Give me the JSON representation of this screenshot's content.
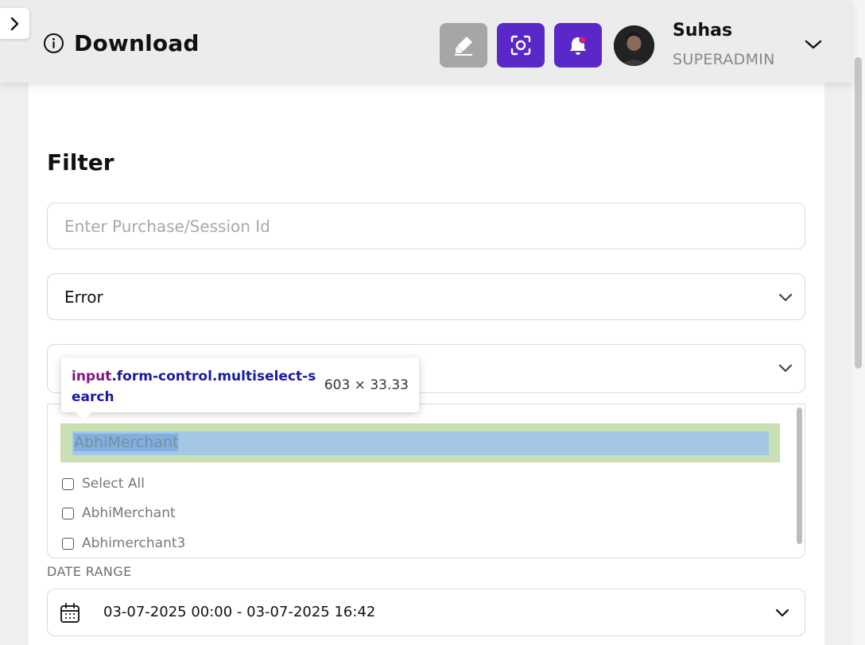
{
  "header": {
    "title": "Download",
    "user": {
      "name": "Suhas",
      "role": "SUPERADMIN"
    }
  },
  "filter": {
    "title": "Filter",
    "purchase_placeholder": "Enter Purchase/Session Id",
    "type_value": "Error"
  },
  "merchant_dropdown": {
    "search_value": "AbhiMerchant",
    "options": [
      "Select All",
      "AbhiMerchant",
      "Abhimerchant3"
    ]
  },
  "inspector_tooltip": {
    "tag": "input",
    "classes": ".form-control.multiselect-search",
    "dimensions": "603 × 33.33"
  },
  "date_range": {
    "label": "DATE RANGE",
    "value": "03-07-2025 00:00 - 03-07-2025 16:42"
  },
  "colors": {
    "accent": "#5a28c8",
    "disabled": "#a6a6a6",
    "notification_dot": "#e0245e"
  }
}
